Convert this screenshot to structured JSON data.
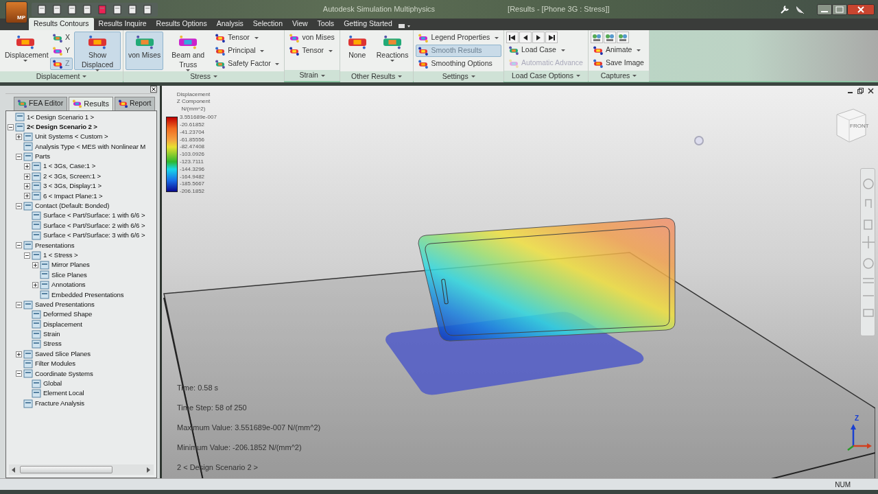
{
  "window": {
    "app_badge": "MP",
    "title": "Autodesk Simulation Multiphysics",
    "document": "[Results - [Phone 3G : Stress]]"
  },
  "ribbon_tabs": [
    {
      "label": "Results Contours",
      "selected": true
    },
    {
      "label": "Results Inquire",
      "selected": false
    },
    {
      "label": "Results Options",
      "selected": false
    },
    {
      "label": "Analysis",
      "selected": false
    },
    {
      "label": "Selection",
      "selected": false
    },
    {
      "label": "View",
      "selected": false
    },
    {
      "label": "Tools",
      "selected": false
    },
    {
      "label": "Getting Started",
      "selected": false
    }
  ],
  "ribbon_groups": [
    {
      "label": "Displacement",
      "items": [
        {
          "kind": "large",
          "label": "Displacement",
          "selected": false,
          "dropdown": true
        },
        {
          "kind": "stack",
          "items": [
            {
              "label": "X",
              "selected": false
            },
            {
              "label": "Y",
              "selected": false
            },
            {
              "label": "Z",
              "selected": true
            }
          ]
        },
        {
          "kind": "large",
          "label": "Show Displaced",
          "selected": true,
          "dropdown": true
        }
      ]
    },
    {
      "label": "Stress",
      "items": [
        {
          "kind": "large",
          "label": "von Mises",
          "selected": true
        },
        {
          "kind": "large",
          "label": "Beam and Truss",
          "selected": false,
          "dropdown": true
        },
        {
          "kind": "stack",
          "items": [
            {
              "label": "Tensor",
              "selected": false,
              "dropdown": true
            },
            {
              "label": "Principal",
              "selected": false,
              "dropdown": true
            },
            {
              "label": "Safety Factor",
              "selected": false,
              "dropdown": true
            }
          ]
        }
      ]
    },
    {
      "label": "Strain",
      "items": [
        {
          "kind": "stack",
          "items": [
            {
              "label": "von Mises",
              "selected": false
            },
            {
              "label": "Tensor",
              "selected": false,
              "dropdown": true
            }
          ]
        }
      ]
    },
    {
      "label": "Other Results",
      "items": [
        {
          "kind": "large",
          "label": "None",
          "selected": false
        },
        {
          "kind": "large",
          "label": "Reactions",
          "selected": false,
          "dropdown": true
        }
      ]
    },
    {
      "label": "Settings",
      "items": [
        {
          "kind": "stack",
          "items": [
            {
              "label": "Legend Properties",
              "selected": false,
              "dropdown": true
            },
            {
              "label": "Smooth Results",
              "selected": true
            },
            {
              "label": "Smoothing Options",
              "selected": false
            }
          ]
        }
      ]
    },
    {
      "label": "Load Case Options",
      "items": [
        {
          "kind": "stack",
          "items": [
            {
              "kind": "player"
            },
            {
              "label": "Load Case",
              "selected": false,
              "dropdown": true
            },
            {
              "label": "Automatic Advance",
              "selected": false,
              "disabled": true
            }
          ]
        }
      ]
    },
    {
      "label": "Captures",
      "items": [
        {
          "kind": "stack",
          "items": [
            {
              "kind": "icons"
            },
            {
              "label": "Animate",
              "selected": false,
              "dropdown": true
            },
            {
              "label": "Save Image",
              "selected": false
            }
          ]
        }
      ]
    }
  ],
  "panel_tabs": [
    {
      "label": "FEA Editor",
      "selected": false
    },
    {
      "label": "Results",
      "selected": true
    },
    {
      "label": "Report",
      "selected": false
    }
  ],
  "tree": [
    {
      "label": "1< Design Scenario 1 >"
    },
    {
      "label": "2< Design Scenario 2 >",
      "bold": true,
      "expanded": true,
      "children": [
        {
          "label": "Unit Systems < Custom >",
          "expanded": false
        },
        {
          "label": "Analysis Type < MES with Nonlinear M"
        },
        {
          "label": "Parts",
          "expanded": true,
          "children": [
            {
              "label": "1 < 3Gs, Case:1 >",
              "expanded": false
            },
            {
              "label": "2 < 3Gs, Screen:1 >",
              "expanded": false
            },
            {
              "label": "3 < 3Gs, Display:1 >",
              "expanded": false
            },
            {
              "label": "6 < Impact Plane:1 >",
              "expanded": false
            }
          ]
        },
        {
          "label": "Contact (Default: Bonded)",
          "expanded": true,
          "children": [
            {
              "label": "Surface < Part/Surface: 1 with 6/6 >"
            },
            {
              "label": "Surface < Part/Surface: 2 with 6/6 >"
            },
            {
              "label": "Surface < Part/Surface: 3 with 6/6 >"
            }
          ]
        },
        {
          "label": "Presentations",
          "expanded": true,
          "children": [
            {
              "label": "1 < Stress >",
              "expanded": true,
              "children": [
                {
                  "label": "Mirror Planes",
                  "expanded": false
                },
                {
                  "label": "Slice Planes"
                },
                {
                  "label": "Annotations",
                  "expanded": false
                },
                {
                  "label": "Embedded Presentations"
                }
              ]
            }
          ]
        },
        {
          "label": "Saved Presentations",
          "expanded": true,
          "children": [
            {
              "label": "Deformed Shape"
            },
            {
              "label": "Displacement"
            },
            {
              "label": "Strain"
            },
            {
              "label": "Stress"
            }
          ]
        },
        {
          "label": "Saved Slice Planes",
          "expanded": false
        },
        {
          "label": "Filter Modules"
        },
        {
          "label": "Coordinate Systems",
          "expanded": true,
          "children": [
            {
              "label": "Global"
            },
            {
              "label": "Element Local"
            }
          ]
        },
        {
          "label": "Fracture Analysis"
        }
      ]
    }
  ],
  "legend": {
    "title": [
      "Displacement",
      "Z Component",
      "N/(mm^2)"
    ],
    "values": [
      "3.551689e-007",
      "-20.61852",
      "-41.23704",
      "-61.85556",
      "-82.47408",
      "-103.0926",
      "-123.7111",
      "-144.3296",
      "-164.9482",
      "-185.5667",
      "-206.1852"
    ]
  },
  "view_cube": {
    "face": "FRONT"
  },
  "info": [
    "Time: 0.58 s",
    "Time Step:  58 of 250",
    "Maximum Value: 3.551689e-007 N/(mm^2)",
    "Minimum Value: -206.1852 N/(mm^2)",
    "2 < Design Scenario 2 >"
  ],
  "triad": {
    "axis": "Z"
  },
  "status_bar": {
    "indicator": "NUM"
  }
}
